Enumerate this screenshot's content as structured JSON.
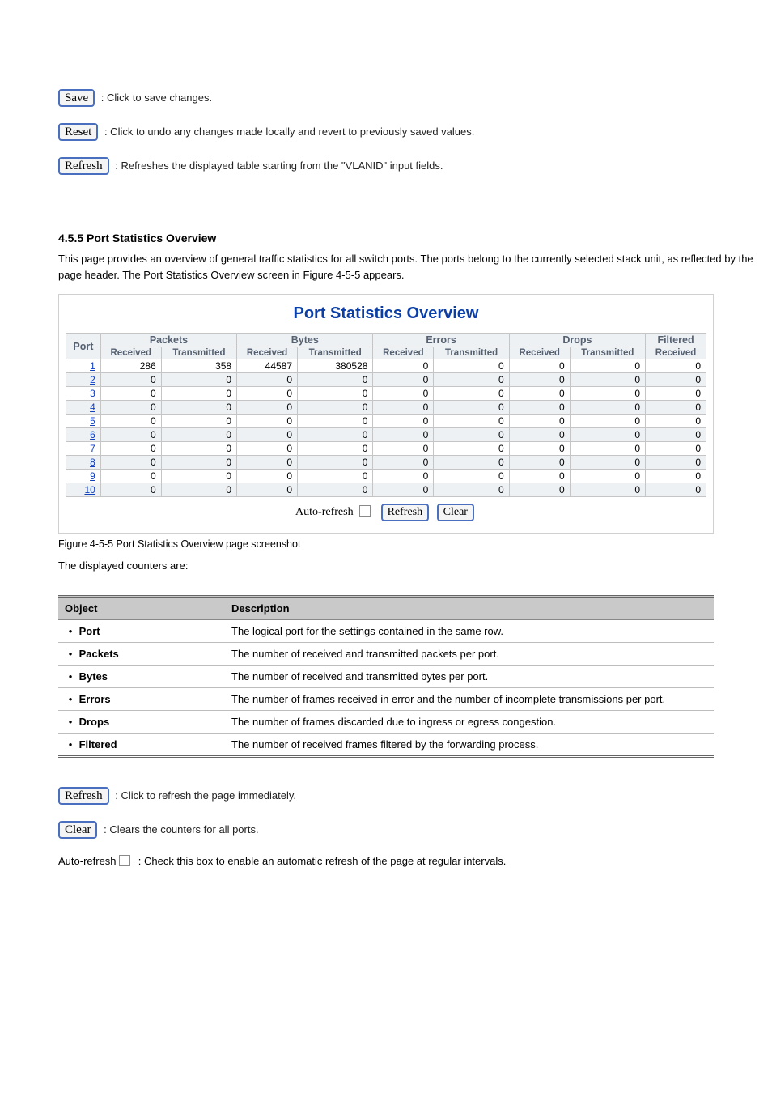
{
  "topButtons": {
    "save": "Save",
    "reset": "Reset",
    "refresh": "Refresh"
  },
  "topDescriptions": {
    "save": ": Click to save changes.",
    "reset": ": Click to undo any changes made locally and revert to previously saved values.",
    "refresh": ": Refreshes the displayed table starting from the \"VLANID\" input fields."
  },
  "sectionHeading": "4.5.5 Port Statistics Overview",
  "sectionIntro": "This page provides an overview of general traffic statistics for all switch ports. The ports belong to the currently selected stack unit, as reflected by the page header. The Port Statistics Overview screen in Figure 4-5-5 appears.",
  "panelTitle": "Port Statistics Overview",
  "chart_data": {
    "type": "table",
    "title": "Port Statistics Overview",
    "columns_group": [
      "Port",
      "Packets",
      "Bytes",
      "Errors",
      "Drops",
      "Filtered"
    ],
    "columns": [
      "Port",
      "Packets Received",
      "Packets Transmitted",
      "Bytes Received",
      "Bytes Transmitted",
      "Errors Received",
      "Errors Transmitted",
      "Drops Received",
      "Drops Transmitted",
      "Filtered Received"
    ],
    "rows": [
      {
        "port": 1,
        "pr": 286,
        "pt": 358,
        "br": 44587,
        "bt": 380528,
        "er": 0,
        "et": 0,
        "dr": 0,
        "dt": 0,
        "fr": 0
      },
      {
        "port": 2,
        "pr": 0,
        "pt": 0,
        "br": 0,
        "bt": 0,
        "er": 0,
        "et": 0,
        "dr": 0,
        "dt": 0,
        "fr": 0
      },
      {
        "port": 3,
        "pr": 0,
        "pt": 0,
        "br": 0,
        "bt": 0,
        "er": 0,
        "et": 0,
        "dr": 0,
        "dt": 0,
        "fr": 0
      },
      {
        "port": 4,
        "pr": 0,
        "pt": 0,
        "br": 0,
        "bt": 0,
        "er": 0,
        "et": 0,
        "dr": 0,
        "dt": 0,
        "fr": 0
      },
      {
        "port": 5,
        "pr": 0,
        "pt": 0,
        "br": 0,
        "bt": 0,
        "er": 0,
        "et": 0,
        "dr": 0,
        "dt": 0,
        "fr": 0
      },
      {
        "port": 6,
        "pr": 0,
        "pt": 0,
        "br": 0,
        "bt": 0,
        "er": 0,
        "et": 0,
        "dr": 0,
        "dt": 0,
        "fr": 0
      },
      {
        "port": 7,
        "pr": 0,
        "pt": 0,
        "br": 0,
        "bt": 0,
        "er": 0,
        "et": 0,
        "dr": 0,
        "dt": 0,
        "fr": 0
      },
      {
        "port": 8,
        "pr": 0,
        "pt": 0,
        "br": 0,
        "bt": 0,
        "er": 0,
        "et": 0,
        "dr": 0,
        "dt": 0,
        "fr": 0
      },
      {
        "port": 9,
        "pr": 0,
        "pt": 0,
        "br": 0,
        "bt": 0,
        "er": 0,
        "et": 0,
        "dr": 0,
        "dt": 0,
        "fr": 0
      },
      {
        "port": 10,
        "pr": 0,
        "pt": 0,
        "br": 0,
        "bt": 0,
        "er": 0,
        "et": 0,
        "dr": 0,
        "dt": 0,
        "fr": 0
      }
    ]
  },
  "headerGroups": {
    "port": "Port",
    "packets": "Packets",
    "bytes": "Bytes",
    "errors": "Errors",
    "drops": "Drops",
    "filtered": "Filtered"
  },
  "subHeaders": {
    "received": "Received",
    "transmitted": "Transmitted"
  },
  "controls": {
    "autoRefresh": "Auto-refresh",
    "refresh": "Refresh",
    "clear": "Clear"
  },
  "figCaption": "Figure 4-5-5 Port Statistics Overview page screenshot",
  "paramIntro": "The displayed counters are:",
  "paramHeaders": {
    "object": "Object",
    "description": "Description"
  },
  "params": [
    {
      "object": "Port",
      "description": "The logical port for the settings contained in the same row."
    },
    {
      "object": "Packets",
      "description": "The number of received and transmitted packets per port."
    },
    {
      "object": "Bytes",
      "description": "The number of received and transmitted bytes per port."
    },
    {
      "object": "Errors",
      "description": "The number of frames received in error and the number of incomplete transmissions per port."
    },
    {
      "object": "Drops",
      "description": "The number of frames discarded due to ingress or egress congestion."
    },
    {
      "object": "Filtered",
      "description": "The number of received frames filtered by the forwarding process."
    }
  ],
  "bottomButtons": {
    "refresh": "Refresh",
    "clear": "Clear"
  },
  "bottomDescriptions": {
    "refresh": ": Click to refresh the page immediately.",
    "clear": ": Clears the counters for all ports.",
    "autoRefresh": ": Check this box to enable an automatic refresh of the page at regular intervals."
  }
}
